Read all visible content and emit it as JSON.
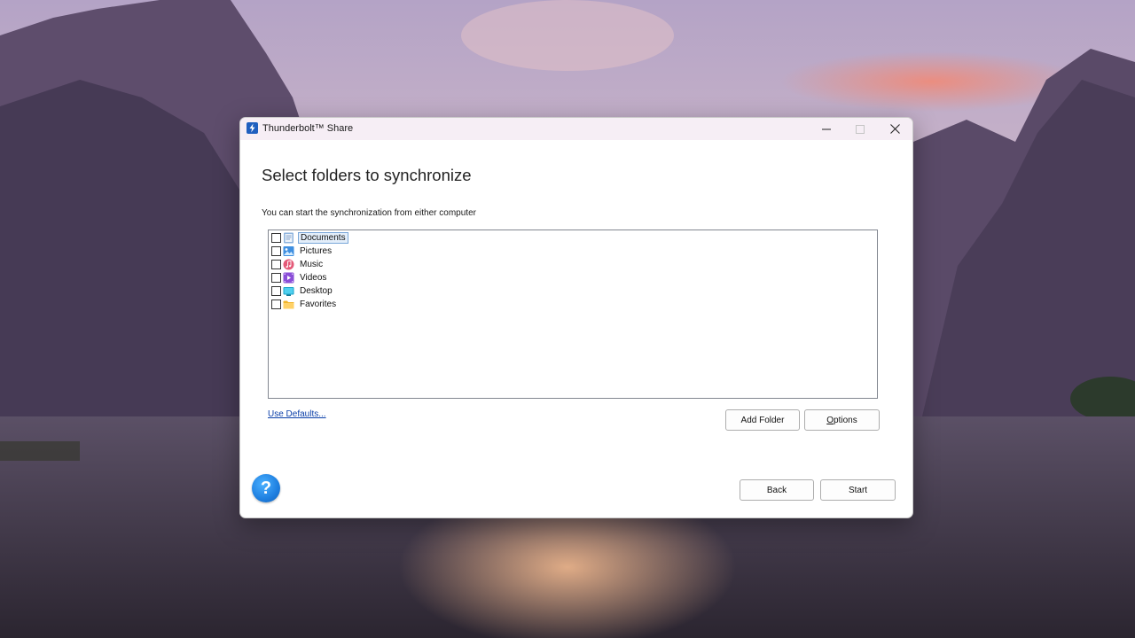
{
  "window": {
    "title": "Thunderbolt™ Share",
    "app_icon": "thunderbolt-icon"
  },
  "content": {
    "heading": "Select folders to synchronize",
    "subtitle": "You can start the synchronization from either computer"
  },
  "folders": [
    {
      "label": "Documents",
      "icon": "documents-icon",
      "checked": false,
      "focused": true
    },
    {
      "label": "Pictures",
      "icon": "pictures-icon",
      "checked": false,
      "focused": false
    },
    {
      "label": "Music",
      "icon": "music-icon",
      "checked": false,
      "focused": false
    },
    {
      "label": "Videos",
      "icon": "videos-icon",
      "checked": false,
      "focused": false
    },
    {
      "label": "Desktop",
      "icon": "desktop-icon",
      "checked": false,
      "focused": false
    },
    {
      "label": "Favorites",
      "icon": "favorites-icon",
      "checked": false,
      "focused": false
    }
  ],
  "actions": {
    "use_defaults": "Use Defaults...",
    "add_folder": "Add Folder",
    "options_first": "O",
    "options_rest": "ptions",
    "back": "Back",
    "start": "Start",
    "help_glyph": "?"
  },
  "colors": {
    "accent": "#1e7fe0",
    "link": "#0a3ea8",
    "titlebar": "#f6eef5"
  }
}
